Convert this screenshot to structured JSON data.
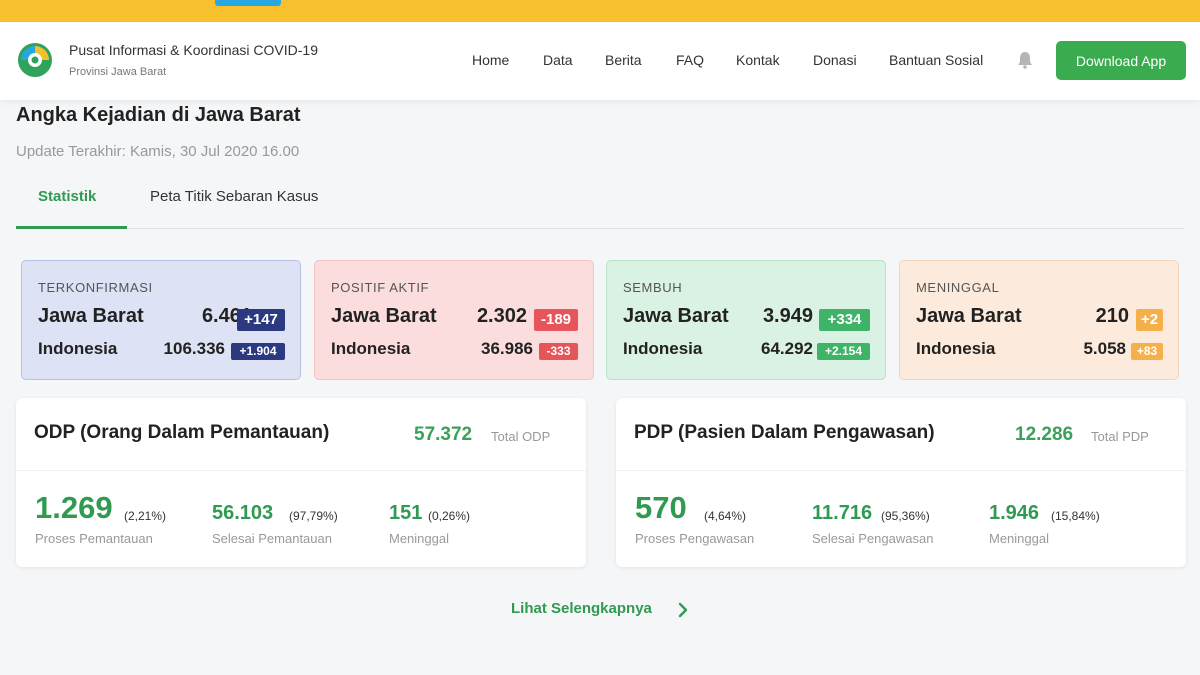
{
  "header": {
    "brand_title": "Pusat Informasi & Koordinasi COVID-19",
    "brand_subtitle": "Provinsi Jawa Barat",
    "nav": [
      "Home",
      "Data",
      "Berita",
      "FAQ",
      "Kontak",
      "Donasi",
      "Bantuan Sosial"
    ],
    "download_label": "Download App",
    "bell_icon": "bell-icon",
    "logo_icon": "pikobar-logo"
  },
  "page": {
    "title": "Angka Kejadian di Jawa Barat",
    "update": "Update Terakhir: Kamis, 30 Jul 2020 16.00"
  },
  "tabs": [
    {
      "label": "Statistik",
      "active": true
    },
    {
      "label": "Peta Titik Sebaran Kasus",
      "active": false
    }
  ],
  "cards": [
    {
      "title": "TERKONFIRMASI",
      "jabar_label": "Jawa Barat",
      "jabar_value": "6.461",
      "jabar_delta": "+147",
      "indo_label": "Indonesia",
      "indo_value": "106.336",
      "indo_delta": "+1.904",
      "badge_color": "#2b3a80"
    },
    {
      "title": "POSITIF AKTIF",
      "jabar_label": "Jawa Barat",
      "jabar_value": "2.302",
      "jabar_delta": "-189",
      "indo_label": "Indonesia",
      "indo_value": "36.986",
      "indo_delta": "-333",
      "badge_color": "#e5555a"
    },
    {
      "title": "SEMBUH",
      "jabar_label": "Jawa Barat",
      "jabar_value": "3.949",
      "jabar_delta": "+334",
      "indo_label": "Indonesia",
      "indo_value": "64.292",
      "indo_delta": "+2.154",
      "badge_color": "#3fb468"
    },
    {
      "title": "MENINGGAL",
      "jabar_label": "Jawa Barat",
      "jabar_value": "210",
      "jabar_delta": "+2",
      "indo_label": "Indonesia",
      "indo_value": "5.058",
      "indo_delta": "+83",
      "badge_color": "#f5b04c"
    }
  ],
  "odp": {
    "title": "ODP (Orang Dalam Pemantauan)",
    "total": "57.372",
    "total_label": "Total ODP",
    "metrics": [
      {
        "value": "1.269",
        "pct": "(2,21%)",
        "label": "Proses Pemantauan"
      },
      {
        "value": "56.103",
        "pct": "(97,79%)",
        "label": "Selesai Pemantauan"
      },
      {
        "value": "151",
        "pct": "(0,26%)",
        "label": "Meninggal"
      }
    ]
  },
  "pdp": {
    "title": "PDP (Pasien Dalam Pengawasan)",
    "total": "12.286",
    "total_label": "Total PDP",
    "metrics": [
      {
        "value": "570",
        "pct": "(4,64%)",
        "label": "Proses Pengawasan"
      },
      {
        "value": "11.716",
        "pct": "(95,36%)",
        "label": "Selesai Pengawasan"
      },
      {
        "value": "1.946",
        "pct": "(15,84%)",
        "label": "Meninggal"
      }
    ]
  },
  "see_more": "Lihat Selengkapnya",
  "colors": {
    "accent": "#2f9a50",
    "topbar": "#f7c12e"
  }
}
